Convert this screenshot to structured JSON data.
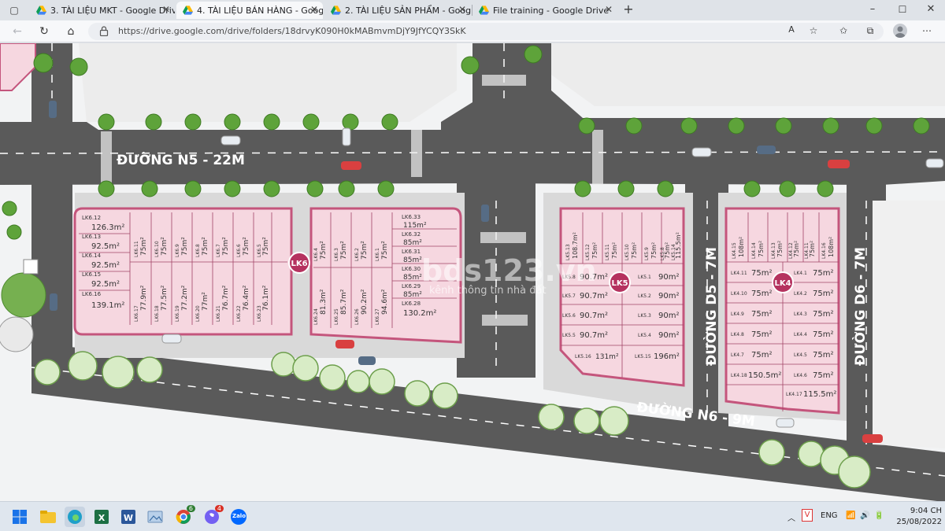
{
  "browser": {
    "tabs": [
      {
        "label": "3. TÀI LIỆU MKT - Google Drive",
        "active": false
      },
      {
        "label": "4. TÀI LIỆU BÁN HÀNG - Google",
        "active": true
      },
      {
        "label": "2. TÀI LIỆU SẢN PHẨM - Google",
        "active": false
      },
      {
        "label": "File training - Google Drive",
        "active": false
      }
    ],
    "new_tab": "+",
    "window_controls": {
      "minimize": "–",
      "maximize": "☐",
      "close": "✕"
    },
    "url": "https://drive.google.com/drive/folders/18drvyK090H0kMABmvmDjY9JfYCQY3SkK",
    "read_aloud": "A",
    "colors": {
      "accent": "#dfe3e8",
      "road": "#5b5b5b",
      "lot": "#f6d7e0",
      "lot_border": "#c4557c",
      "badge": "#b5325f"
    }
  },
  "map": {
    "roads": {
      "n5": "ĐƯỜNG N5 - 22M",
      "n6": "ĐƯỜNG N6 - 9M",
      "d5": "ĐƯỜNG D5 - 7M",
      "d6": "ĐƯỜNG D6 - 7M"
    },
    "watermark": "bds123.vn",
    "watermark_sub": "kênh thông tin nhà đất",
    "blocks": [
      {
        "badge": "LK6",
        "left": [
          {
            "id": "LK6.12",
            "area": "126.3m²"
          },
          {
            "id": "LK6.13",
            "area": "92.5m²"
          },
          {
            "id": "LK6.14",
            "area": "92.5m²"
          },
          {
            "id": "LK6.15",
            "area": "92.5m²"
          },
          {
            "id": "LK6.16",
            "area": "139.1m²"
          }
        ],
        "top_row": [
          "75m²",
          "75m²",
          "75m²",
          "75m²",
          "75m²",
          "75m²",
          "75m²"
        ],
        "top_ids": [
          "LK6.11",
          "LK6.10",
          "LK6.9",
          "LK6.8",
          "LK6.7",
          "LK6.6",
          "LK6.5"
        ],
        "bottom_row": [
          "77.9m²",
          "77.5m²",
          "77.2m²",
          "77m²",
          "76.7m²",
          "76.4m²",
          "76.1m²"
        ],
        "bottom_ids": [
          "LK6.17",
          "LK6.18",
          "LK6.19",
          "LK6.20",
          "LK6.21",
          "LK6.22",
          "LK6.23"
        ]
      },
      {
        "right_top": [
          "75m²",
          "75m²",
          "75m²",
          "75m²"
        ],
        "right_top_ids": [
          "LK6.4",
          "LK6.3",
          "LK6.2",
          "LK6.1"
        ],
        "right_bottom": [
          "81.3m²",
          "85.7m²",
          "90.2m²",
          "94.6m²"
        ],
        "right_bottom_ids": [
          "LK6.24",
          "LK6.25",
          "LK6.26",
          "LK6.27"
        ],
        "column": [
          {
            "id": "LK6.33",
            "area": "115m²"
          },
          {
            "id": "LK6.32",
            "area": "85m²"
          },
          {
            "id": "LK6.31",
            "area": "85m²"
          },
          {
            "id": "LK6.30",
            "area": "85m²"
          },
          {
            "id": "LK6.29",
            "area": "85m²"
          },
          {
            "id": "LK6.28",
            "area": "130.2m²"
          }
        ]
      },
      {
        "badge": "LK5",
        "top": [
          "108.7m²",
          "75m²",
          "75m²",
          "75m²",
          "75m²",
          "75m²",
          "115.5m²"
        ],
        "top_ids": [
          "LK5.13",
          "LK5.12",
          "LK5.11",
          "LK5.10",
          "LK5.9",
          "LK5.8",
          "LK5.14"
        ],
        "left": [
          {
            "id": "LK5.8",
            "area": "90.7m²"
          },
          {
            "id": "LK5.7",
            "area": "90.7m²"
          },
          {
            "id": "LK5.6",
            "area": "90.7m²"
          },
          {
            "id": "LK5.5",
            "area": "90.7m²"
          },
          {
            "id": "LK5.16",
            "area": "131m²"
          }
        ],
        "right": [
          {
            "id": "LK5.1",
            "area": "90m²"
          },
          {
            "id": "LK5.2",
            "area": "90m²"
          },
          {
            "id": "LK5.3",
            "area": "90m²"
          },
          {
            "id": "LK5.4",
            "area": "90m²"
          },
          {
            "id": "LK5.15",
            "area": "196m²"
          }
        ]
      },
      {
        "badge": "LK4",
        "top": [
          "108m²",
          "75m²",
          "75m²",
          "75m²",
          "75m²",
          "108m²"
        ],
        "top_ids": [
          "LK4.15",
          "LK4.14",
          "LK4.13",
          "LK4.12",
          "LK4.11",
          "LK4.16"
        ],
        "left": [
          {
            "id": "LK4.11",
            "area": "75m²"
          },
          {
            "id": "LK4.10",
            "area": "75m²"
          },
          {
            "id": "LK4.9",
            "area": "75m²"
          },
          {
            "id": "LK4.8",
            "area": "75m²"
          },
          {
            "id": "LK4.7",
            "area": "75m²"
          },
          {
            "id": "LK4.18",
            "area": "150.5m²"
          }
        ],
        "right": [
          {
            "id": "LK4.1",
            "area": "75m²"
          },
          {
            "id": "LK4.2",
            "area": "75m²"
          },
          {
            "id": "LK4.3",
            "area": "75m²"
          },
          {
            "id": "LK4.4",
            "area": "75m²"
          },
          {
            "id": "LK4.5",
            "area": "75m²"
          },
          {
            "id": "LK4.6",
            "area": "75m²"
          },
          {
            "id": "LK4.17",
            "area": "115.5m²"
          }
        ]
      }
    ]
  },
  "taskbar": {
    "badges": {
      "chrome": "6",
      "viber": "4"
    },
    "zalo": "Zalo",
    "lang": "ENG",
    "time": "9:04 CH",
    "date": "25/08/2022"
  }
}
